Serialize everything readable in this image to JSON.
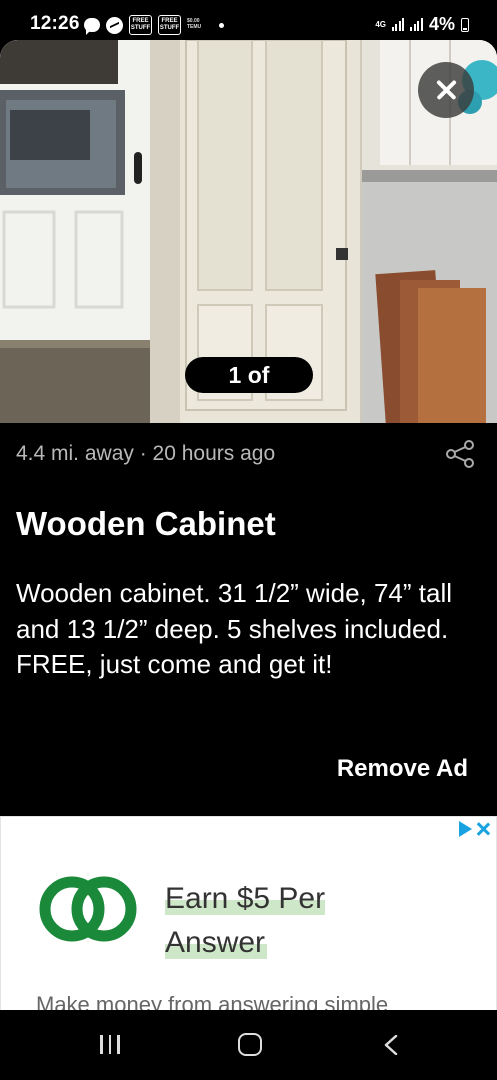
{
  "status_bar": {
    "time": "12:26",
    "notification_icons": [
      "chat-icon",
      "messenger-icon",
      "free-stuff-icon",
      "free-stuff-icon",
      "temu-icon"
    ],
    "free_label": "FREE STUFF",
    "temu_label": "$0.00 TEMU",
    "network": "4G",
    "battery": "4%"
  },
  "listing": {
    "photo_counter": "1 of",
    "meta": "4.4 mi. away · 20 hours ago",
    "title": "Wooden Cabinet",
    "description": "Wooden cabinet. 31 1/2” wide, 74” tall and 13 1/2” deep. 5 shelves included. FREE, just come and get it!",
    "remove_ad_label": "Remove Ad"
  },
  "ad": {
    "headline": "Earn $5 Per Answer",
    "subtext": "Make money from answering simple",
    "brand_color": "#1a8a3a",
    "choices_color": "#19a2e0"
  },
  "nav": {
    "buttons": [
      "recents",
      "home",
      "back"
    ]
  }
}
